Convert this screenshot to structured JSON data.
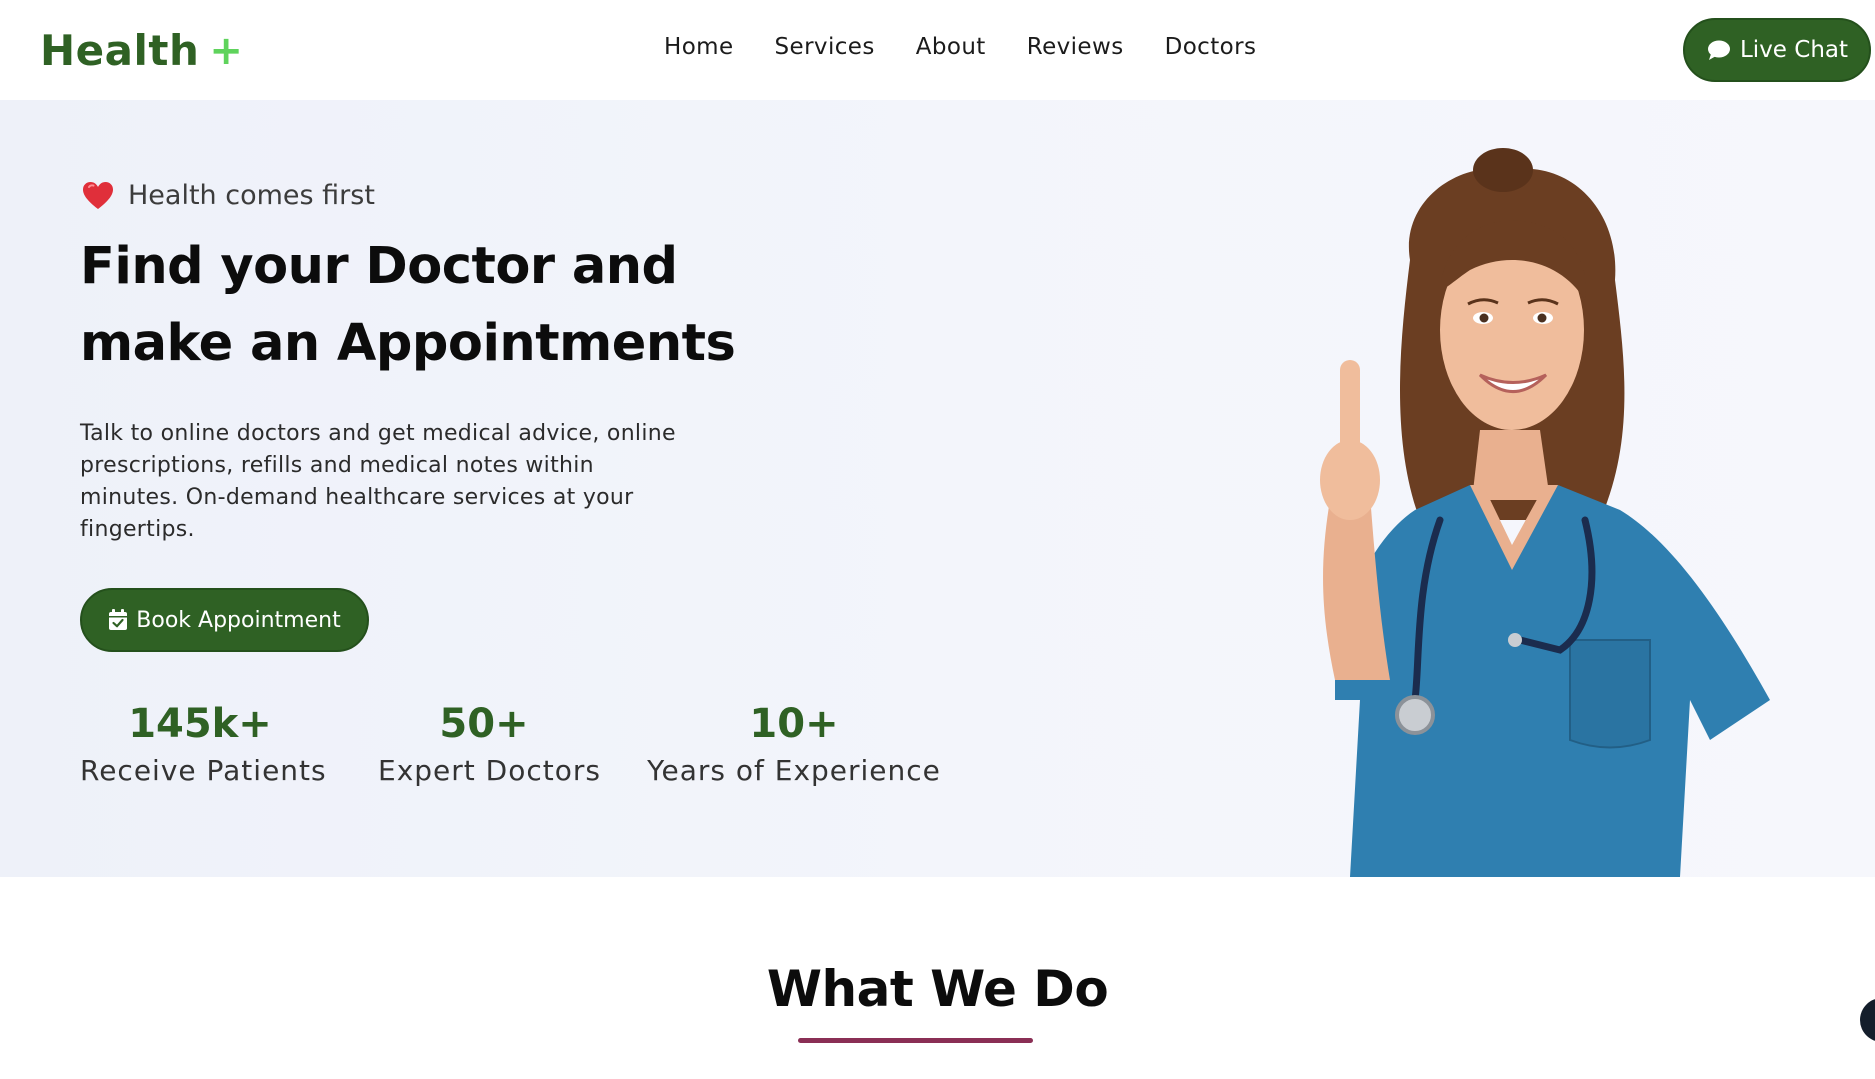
{
  "header": {
    "logo_text": "Health",
    "logo_symbol": "+",
    "nav": [
      "Home",
      "Services",
      "About",
      "Reviews",
      "Doctors"
    ],
    "live_chat_label": "Live Chat",
    "live_chat_icon": "chat-bubble-icon"
  },
  "hero": {
    "tagline": "Health comes first",
    "tagline_icon": "heart-icon",
    "title_line1": "Find your Doctor and",
    "title_line2": "make an Appointments",
    "description": "Talk to online doctors and get medical advice, online prescriptions, refills and medical notes within minutes. On-demand healthcare services at your fingertips.",
    "cta_label": "Book Appointment",
    "cta_icon": "calendar-check-icon",
    "stats": [
      {
        "value": "145k+",
        "label": "Receive Patients"
      },
      {
        "value": "50+",
        "label": "Expert Doctors"
      },
      {
        "value": "10+",
        "label": "Years of Experience"
      }
    ]
  },
  "section": {
    "title": "What We Do"
  },
  "colors": {
    "brand_green": "#2f6124",
    "plus_green": "#5fd35c",
    "accent_underline": "#8a2f55",
    "hero_bg": "#f2f4fb"
  }
}
